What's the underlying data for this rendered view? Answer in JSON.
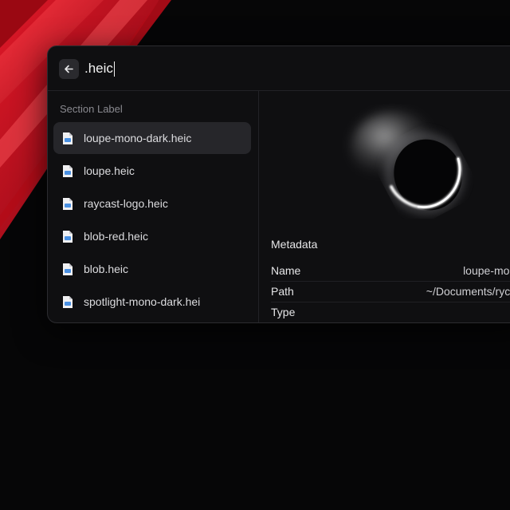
{
  "search": {
    "query": ".heic"
  },
  "list": {
    "section_label": "Section Label",
    "items": [
      {
        "label": "loupe-mono-dark.heic",
        "selected": true
      },
      {
        "label": "loupe.heic",
        "selected": false
      },
      {
        "label": "raycast-logo.heic",
        "selected": false
      },
      {
        "label": "blob-red.heic",
        "selected": false
      },
      {
        "label": "blob.heic",
        "selected": false
      },
      {
        "label": "spotlight-mono-dark.hei",
        "selected": false
      }
    ]
  },
  "detail": {
    "metadata_title": "Metadata",
    "rows": [
      {
        "key": "Name",
        "value": "loupe-mono"
      },
      {
        "key": "Path",
        "value": "~/Documents/rycst/"
      },
      {
        "key": "Type",
        "value": ""
      }
    ]
  },
  "colors": {
    "wallpaper_red": "#c8101e",
    "window_bg": "#0f0f11",
    "selected_bg": "#26262a",
    "file_icon_accent": "#4a90e2"
  },
  "icons": {
    "back": "arrow-left-icon",
    "file": "file-image-icon"
  }
}
